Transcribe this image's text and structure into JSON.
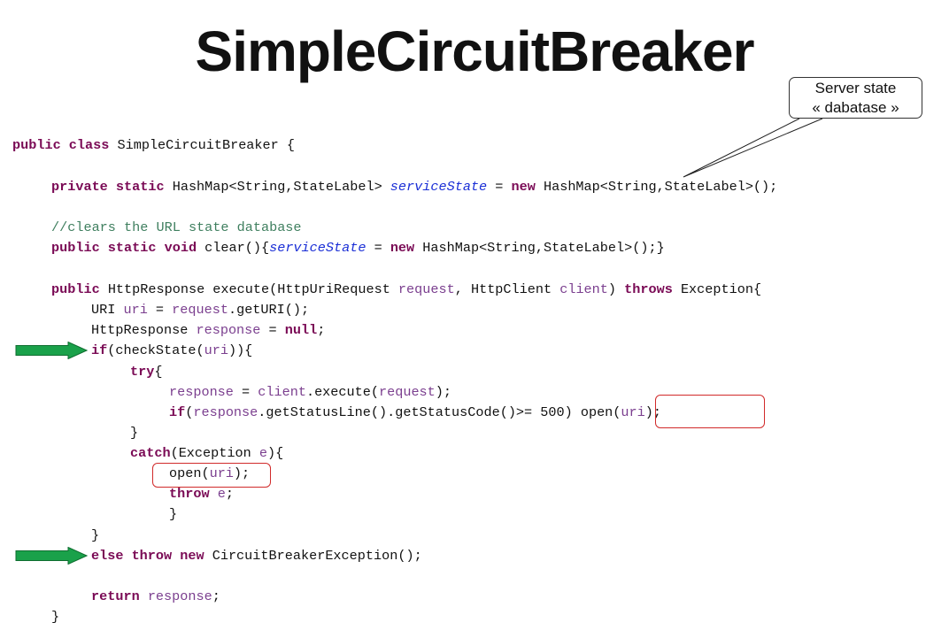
{
  "title": "SimpleCircuitBreaker",
  "callout": {
    "line1": "Server state",
    "line2": "« dabatase »"
  },
  "code": {
    "l1_kw": "public class ",
    "l1_rest": "SimpleCircuitBreaker {",
    "l2_kw": "private static ",
    "l2_a": "HashMap<String,StateLabel> ",
    "l2_field": "serviceState",
    "l2_b": " = ",
    "l2_new": "new",
    "l2_c": " HashMap<String,StateLabel>();",
    "l3_comment": "//clears the URL state database",
    "l4_kw": "public static void ",
    "l4_a": "clear(){",
    "l4_field": "serviceState",
    "l4_b": " = ",
    "l4_new": "new",
    "l4_c": " HashMap<String,StateLabel>();}",
    "l5_kw": "public ",
    "l5_a": "HttpResponse execute(HttpUriRequest ",
    "l5_v1": "request",
    "l5_b": ", HttpClient ",
    "l5_v2": "client",
    "l5_c": ") ",
    "l5_throws": "throws",
    "l5_d": " Exception{",
    "l6_a": "URI ",
    "l6_v1": "uri",
    "l6_b": " = ",
    "l6_v2": "request",
    "l6_c": ".getURI();",
    "l7_a": "HttpResponse ",
    "l7_v1": "response",
    "l7_b": " = ",
    "l7_null": "null",
    "l7_c": ";",
    "l8_if": "if",
    "l8_a": "(checkState(",
    "l8_v": "uri",
    "l8_b": ")){",
    "l9_try": "try",
    "l9_a": "{",
    "l10_v1": "response",
    "l10_a": " = ",
    "l10_v2": "client",
    "l10_b": ".execute(",
    "l10_v3": "request",
    "l10_c": ");",
    "l11_if": "if",
    "l11_a": "(",
    "l11_v": "response",
    "l11_b": ".getStatusLine().getStatusCode()>= 500) ",
    "l11_c": "open(",
    "l11_v2": "uri",
    "l11_d": ");",
    "l12": "}",
    "l13_catch": "catch",
    "l13_a": "(Exception ",
    "l13_v": "e",
    "l13_b": "){",
    "l14_a": "open(",
    "l14_v": "uri",
    "l14_b": ");",
    "l15_throw": "throw",
    "l15_a": " ",
    "l15_v": "e",
    "l15_b": ";",
    "l16": "}",
    "l17": "}",
    "l18_kw": "else throw new ",
    "l18_a": "CircuitBreakerException();",
    "l19_kw": "return ",
    "l19_v": "response",
    "l19_a": ";",
    "l20": "}"
  },
  "colors": {
    "keyword": "#7a0a55",
    "field": "#1b2fd6",
    "comment": "#3f7f5f",
    "variable": "#7b3f8f",
    "arrow_fill": "#1aa14a",
    "highlight_border": "#d12a2a"
  },
  "icons": [
    "green-right-arrow-icon"
  ]
}
